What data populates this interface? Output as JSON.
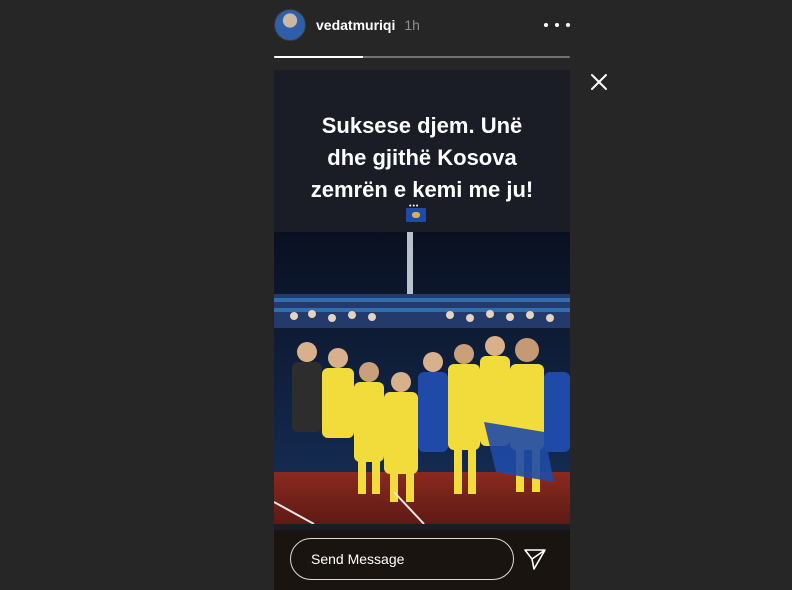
{
  "story": {
    "username": "vedatmuriqi",
    "timestamp": "1h",
    "progress": 0.3,
    "caption_lines": [
      "Suksese djem. Unë",
      "dhe gjithë Kosova",
      "zemrën e kemi me ju!"
    ],
    "flag_icon": "kosovo-flag-icon",
    "photo": "Kosovo football team celebrating in yellow jerseys at night stadium"
  },
  "controls": {
    "more_icon": "more-options-icon",
    "close_icon": "close-icon",
    "send_icon": "send-icon"
  },
  "reply": {
    "placeholder": "Send Message"
  },
  "colors": {
    "background": "#262626",
    "jersey": "#f2dc3c",
    "jersey_blue": "#1f4aa8"
  }
}
